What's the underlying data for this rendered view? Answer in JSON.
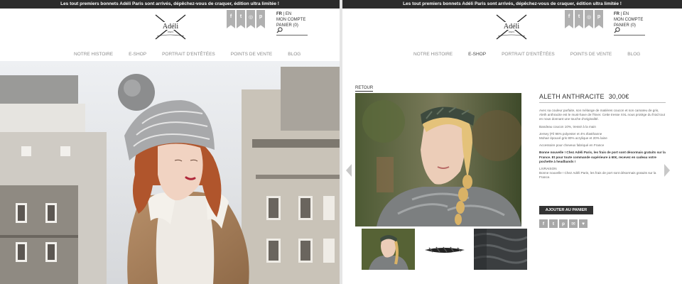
{
  "promo_text": "Les tout premiers bonnets Adéli Paris sont arrivés, dépêchez-vous de craquer, édition ultra limitée !",
  "brand": {
    "logo_text": "Adéli",
    "logo_sub": "PARIS"
  },
  "social": {
    "icons": [
      "facebook-icon",
      "twitter-icon",
      "instagram-icon",
      "pinterest-icon"
    ],
    "glyphs": [
      "f",
      "t",
      "◎",
      "p"
    ]
  },
  "account": {
    "lang_active": "FR",
    "lang_sep": "|",
    "lang_other": "EN",
    "account_label": "MON COMPTE",
    "cart_label": "PANIER (0)"
  },
  "nav": {
    "items": [
      "NOTRE HISTOIRE",
      "E-SHOP",
      "PORTRAIT D'ENTÊTÉES",
      "POINTS DE VENTE",
      "BLOG"
    ],
    "active_left": "",
    "active_right": "E-SHOP"
  },
  "product": {
    "back_label": "RETOUR",
    "name": "ALETH ANTHRACITE",
    "price": "30,00€",
    "paragraphs": [
      "Avec sa couleur parfaite, son mélange de matières coucon et son camaïeu de gris, Aleth anthracite est le must-have de l'hiver. Cette tresse XXL nous protège du froid tout en nous donnant une touche d'originalité.",
      "Bandeau coucon 10%, tressé à la main",
      "Jersey (Fil 96% polyester et 4% élasthanne\nMohair épouvé gris 80% acrylique et 20% laine",
      "Accessoire pour cheveux fabriqué en France"
    ],
    "notice_bold": "Bonne nouvelle ! Chez Adéli Paris, les frais de port sont désormais gratuits sur la France. Et pour toute commande supérieure à 60€, recevez en cadeau votre pochette à headbands !",
    "delivery_title": "LIVRAISON",
    "delivery_text": "Bonne nouvelle ! Chez Adéli Paris, les frais de port sont désormais gratuits sur la France.",
    "add_to_cart": "AJOUTER AU PANIER",
    "share_icons": [
      "facebook-icon",
      "twitter-icon",
      "pinterest-icon",
      "email-icon",
      "heart-icon"
    ],
    "share_glyphs": [
      "f",
      "t",
      "p",
      "✉",
      "♥"
    ]
  },
  "colors": {
    "promo_bg": "#2b2b2b",
    "button_bg": "#333333",
    "ribbon": "#b0b0b0",
    "nav_text": "#8a8a8a"
  }
}
